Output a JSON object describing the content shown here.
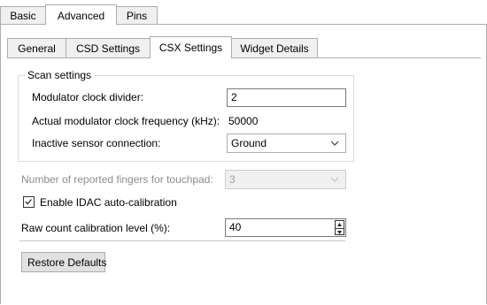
{
  "outer_tabs": [
    {
      "label": "Basic",
      "active": false
    },
    {
      "label": "Advanced",
      "active": true
    },
    {
      "label": "Pins",
      "active": false
    }
  ],
  "inner_tabs": [
    {
      "label": "General",
      "active": false
    },
    {
      "label": "CSD Settings",
      "active": false
    },
    {
      "label": "CSX Settings",
      "active": true
    },
    {
      "label": "Widget Details",
      "active": false
    }
  ],
  "scan_settings": {
    "title": "Scan settings",
    "modulator_clock_divider": {
      "label": "Modulator clock divider:",
      "value": "2"
    },
    "actual_frequency": {
      "label": "Actual modulator clock frequency (kHz):",
      "value": "50000"
    },
    "inactive_sensor_connection": {
      "label": "Inactive sensor connection:",
      "value": "Ground"
    }
  },
  "reported_fingers": {
    "label": "Number of reported fingers for touchpad:",
    "value": "3",
    "disabled": true
  },
  "idac_auto_calibration": {
    "label": "Enable IDAC auto-calibration",
    "checked": true
  },
  "raw_count_level": {
    "label": "Raw count calibration level (%):",
    "value": "40"
  },
  "restore_defaults": {
    "label": "Restore Defaults"
  }
}
